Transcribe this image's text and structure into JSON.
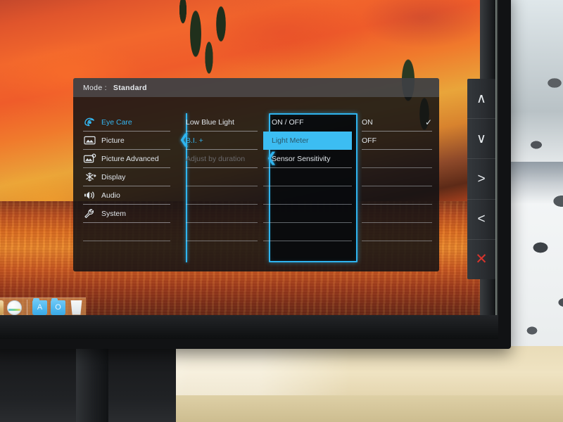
{
  "scene": {
    "description": "Photograph of a monitor displaying its on-screen-display settings menu",
    "wallpaper": "autumn-mountain-lake-photo",
    "desk": "light-wood-desk",
    "curtain": "white-polka-dot-curtain"
  },
  "osd": {
    "header": {
      "mode_label": "Mode :",
      "mode_value": "Standard"
    },
    "columns": {
      "menu": {
        "items": [
          {
            "label": "Eye Care",
            "icon": "eye-icon",
            "state": "active"
          },
          {
            "label": "Picture",
            "icon": "picture-icon",
            "state": "normal"
          },
          {
            "label": "Picture Advanced",
            "icon": "picture-advanced-icon",
            "state": "normal"
          },
          {
            "label": "Display",
            "icon": "snowflake-icon",
            "state": "normal"
          },
          {
            "label": "Audio",
            "icon": "speaker-icon",
            "state": "normal"
          },
          {
            "label": "System",
            "icon": "wrench-icon",
            "state": "normal"
          }
        ]
      },
      "submenu": {
        "items": [
          {
            "label": "Low Blue Light",
            "state": "normal"
          },
          {
            "label": "B.I. +",
            "state": "active"
          },
          {
            "label": "Adjust by duration",
            "state": "disabled"
          }
        ]
      },
      "options": {
        "items": [
          {
            "label": "ON / OFF",
            "state": "normal"
          },
          {
            "label": "Light Meter",
            "state": "selected"
          },
          {
            "label": "Sensor Sensitivity",
            "state": "normal"
          }
        ]
      },
      "values": {
        "items": [
          {
            "label": "ON",
            "checked": true
          },
          {
            "label": "OFF",
            "checked": false
          }
        ],
        "check_glyph": "✓"
      }
    }
  },
  "buttons": {
    "items": [
      {
        "name": "up-button",
        "glyph": "∧"
      },
      {
        "name": "down-button",
        "glyph": "∨"
      },
      {
        "name": "right-button",
        "glyph": ">"
      },
      {
        "name": "left-button",
        "glyph": "<"
      },
      {
        "name": "close-button",
        "glyph": "✕"
      }
    ]
  },
  "dock": {
    "items": [
      {
        "name": "stacks-icon",
        "glyph": ""
      },
      {
        "name": "disc-icon",
        "glyph": ""
      },
      {
        "name": "folder-a-icon",
        "glyph": "A"
      },
      {
        "name": "folder-o-icon",
        "glyph": "O"
      },
      {
        "name": "trash-icon",
        "glyph": ""
      }
    ]
  },
  "colors": {
    "accent_cyan": "#2fb4ef",
    "selection_cyan": "#3cbdf2",
    "close_red": "#d8342c",
    "osd_background": "#121214",
    "text_primary": "#e9edf0",
    "text_disabled": "#6a6a6c"
  }
}
